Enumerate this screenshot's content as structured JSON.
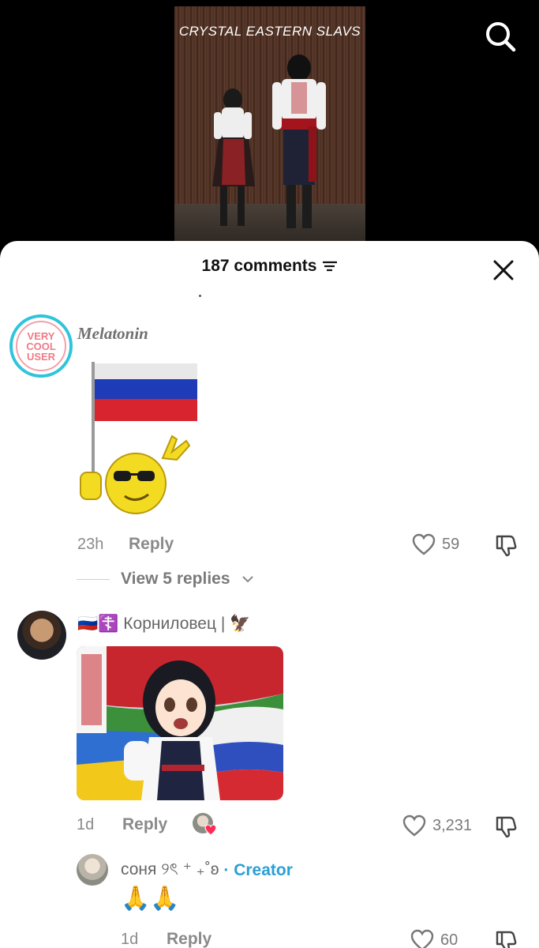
{
  "video": {
    "caption": "CRYSTAL EASTERN SLAVS"
  },
  "sheet": {
    "comment_count": "187 comments"
  },
  "comments": [
    {
      "username": "Melatonin",
      "avatar_text": "VERY COOL USER",
      "time": "23h",
      "reply_label": "Reply",
      "likes": "59",
      "view_replies": "View 5 replies"
    },
    {
      "username_prefix": "🇷🇺☦️",
      "username": "Корниловец | 🦅",
      "time": "1d",
      "reply_label": "Reply",
      "likes": "3,231"
    },
    {
      "username": "соня ୨ৎ ⁺ ₊˚ʚ",
      "creator_label": "· Creator",
      "text": "🙏🙏",
      "time": "1d",
      "reply_label": "Reply",
      "likes": "60"
    }
  ],
  "colors": {
    "creator": "#2aa0d4",
    "muted": "#8a8a8a",
    "sheet_bg": "#ffffff"
  },
  "icons": [
    "search-icon",
    "filter-icon",
    "close-icon",
    "heart-icon",
    "dislike-icon",
    "chevron-down-icon"
  ]
}
